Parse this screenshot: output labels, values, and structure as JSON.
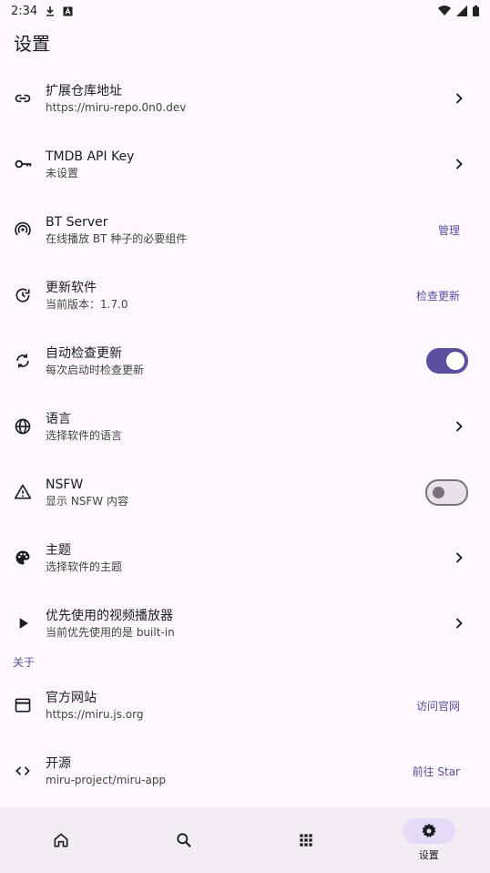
{
  "status": {
    "time": "2:34"
  },
  "page": {
    "title": "设置"
  },
  "items": [
    {
      "title": "扩展仓库地址",
      "sub": "https://miru-repo.0n0.dev"
    },
    {
      "title": "TMDB API Key",
      "sub": "未设置"
    },
    {
      "title": "BT Server",
      "sub": "在线播放 BT 种子的必要组件",
      "action": "管理"
    },
    {
      "title": "更新软件",
      "sub": "当前版本：1.7.0",
      "action": "检查更新"
    },
    {
      "title": "自动检查更新",
      "sub": "每次启动时检查更新",
      "toggle": true
    },
    {
      "title": "语言",
      "sub": "选择软件的语言"
    },
    {
      "title": "NSFW",
      "sub": "显示 NSFW 内容",
      "toggle": false
    },
    {
      "title": "主题",
      "sub": "选择软件的主题"
    },
    {
      "title": "优先使用的视频播放器",
      "sub": "当前优先使用的是 built-in"
    }
  ],
  "about": {
    "label": "关于",
    "items": [
      {
        "title": "官方网站",
        "sub": "https://miru.js.org",
        "action": "访问官网"
      },
      {
        "title": "开源",
        "sub": "miru-project/miru-app",
        "action": "前往 Star"
      }
    ]
  },
  "nav": {
    "settings_label": "设置"
  },
  "colors": {
    "accent": "#5b4ea0",
    "background": "#fdf8fd",
    "nav_bg": "#f2ecf4"
  }
}
